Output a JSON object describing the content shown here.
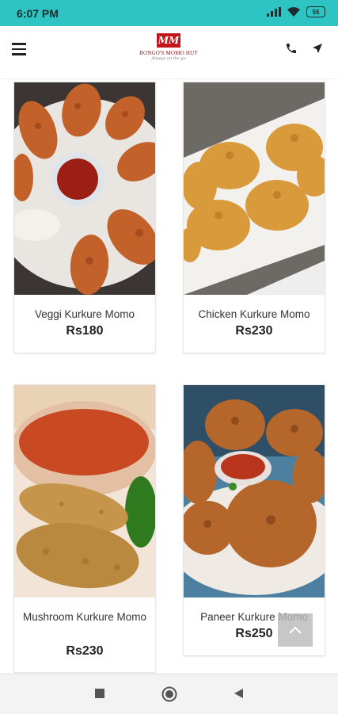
{
  "status_bar": {
    "time": "6:07 PM",
    "battery": "55"
  },
  "header": {
    "logo_mark": "MM",
    "logo_name": "BONGO'S MOMO HUT",
    "logo_tagline": "Always on the go"
  },
  "products": [
    {
      "name": "Veggi Kurkure Momo",
      "price": "Rs180"
    },
    {
      "name": "Chicken Kurkure Momo",
      "price": "Rs230"
    },
    {
      "name": "Mushroom Kurkure Momo",
      "price": "Rs230"
    },
    {
      "name": "Paneer Kurkure Momo",
      "price": "Rs250"
    }
  ],
  "icons": {
    "menu": "hamburger-menu-icon",
    "phone": "phone-icon",
    "location": "navigation-arrow-icon",
    "scroll_top": "chevron-up-icon",
    "nav_recent": "square-icon",
    "nav_home": "circle-icon",
    "nav_back": "triangle-back-icon"
  },
  "colors": {
    "status_bar": "#2ec4c4",
    "brand": "#c4141b"
  }
}
